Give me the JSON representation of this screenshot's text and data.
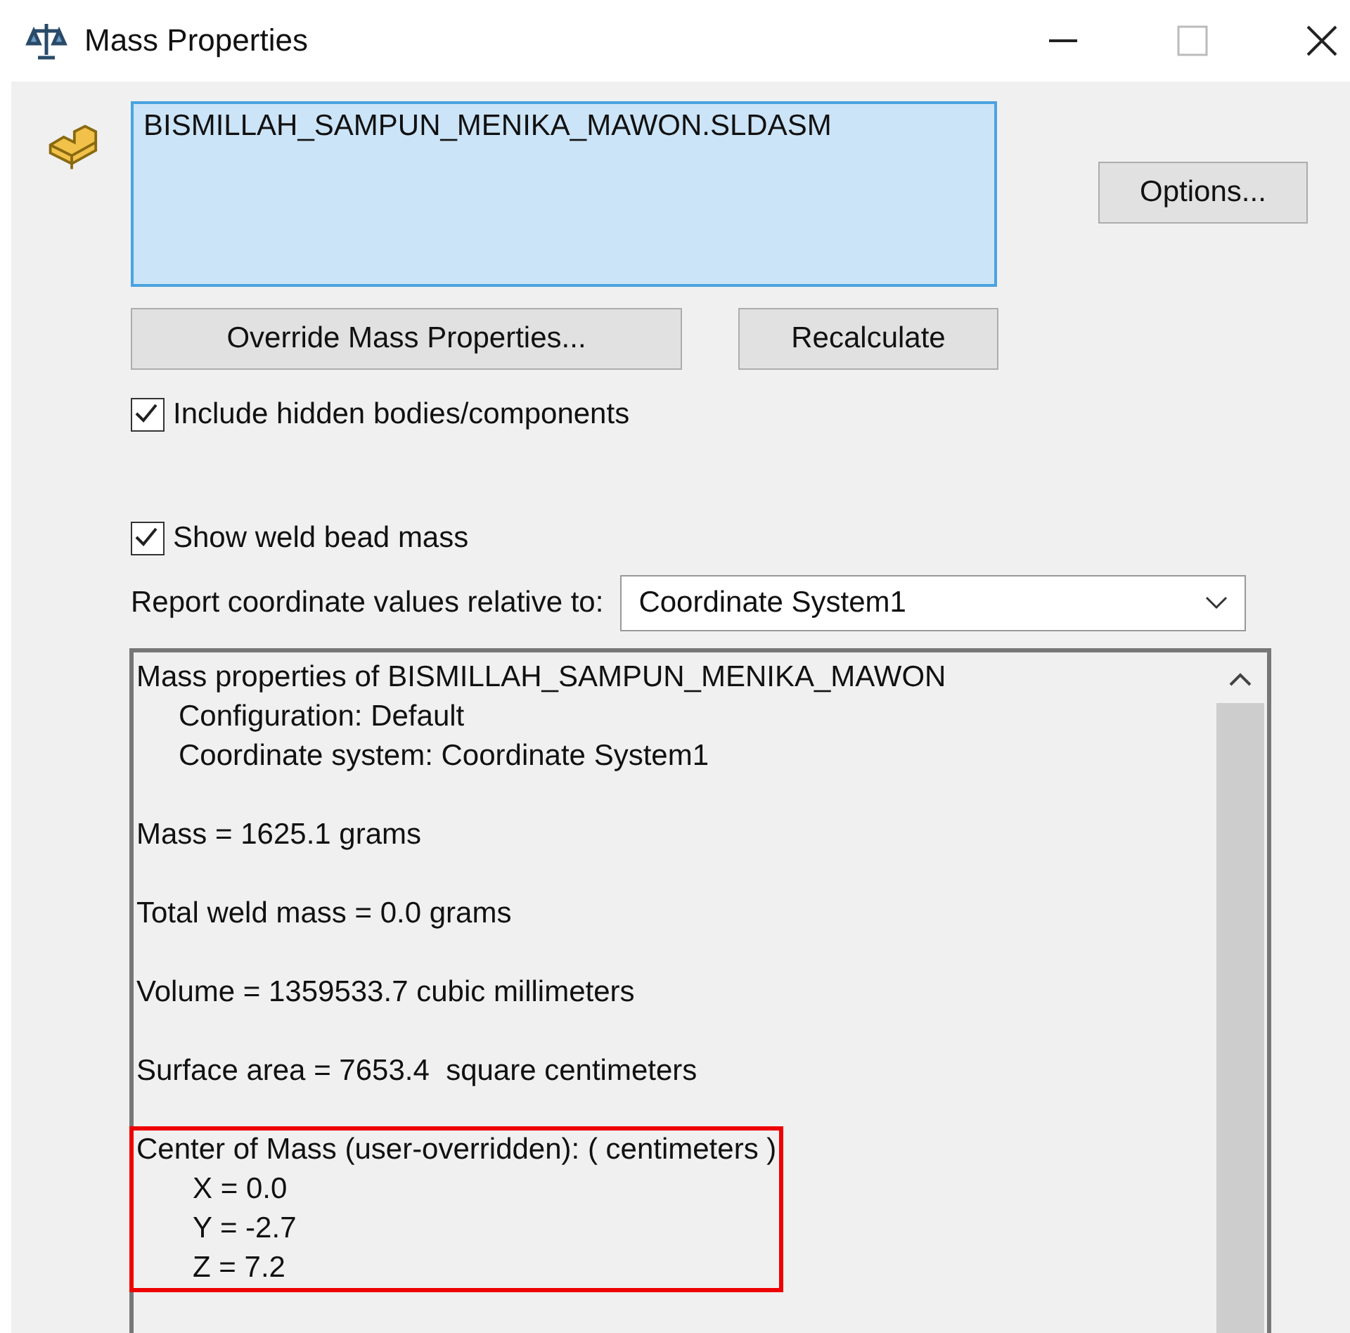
{
  "window": {
    "title": "Mass Properties"
  },
  "selection": {
    "items": [
      {
        "label": "BISMILLAH_SAMPUN_MENIKA_MAWON.SLDASM",
        "selected": true
      }
    ]
  },
  "buttons": {
    "options": "Options...",
    "override": "Override Mass Properties...",
    "recalculate": "Recalculate"
  },
  "checkboxes": [
    {
      "label": "Include hidden bodies/components",
      "checked": true
    },
    {
      "label": "Show weld bead mass",
      "checked": true
    }
  ],
  "coordinate": {
    "label": "Report coordinate values relative to:",
    "value": "Coordinate System1"
  },
  "report": [
    {
      "text": "Mass properties of BISMILLAH_SAMPUN_MENIKA_MAWON",
      "highlighted": false,
      "children": [
        "Configuration: Default",
        "Coordinate system: Coordinate System1"
      ]
    },
    {
      "text": "Mass = 1625.1 grams",
      "highlighted": false
    },
    {
      "text": "Total weld mass = 0.0 grams",
      "highlighted": false
    },
    {
      "text": "Volume = 1359533.7 cubic millimeters",
      "highlighted": false
    },
    {
      "text": "Surface area = 7653.4  square centimeters",
      "highlighted": false
    },
    {
      "text": "Center of Mass (user-overridden): ( centimeters )",
      "highlighted": true,
      "children": [
        "X = 0.0",
        "Y = -2.7",
        "Z = 7.2"
      ]
    }
  ]
}
